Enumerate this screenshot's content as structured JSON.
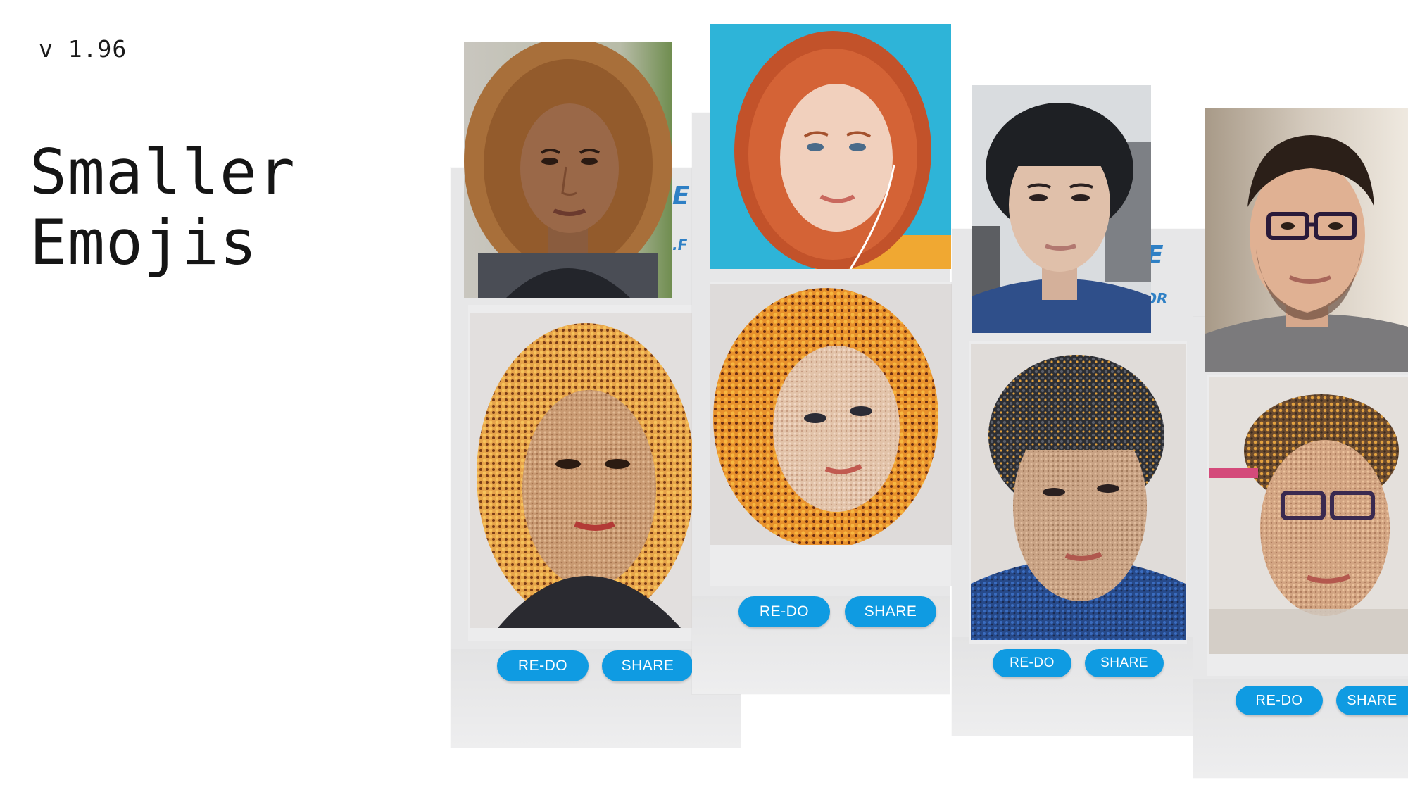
{
  "header": {
    "version": "v 1.96",
    "title_line1": "Smaller",
    "title_line2": "Emojis"
  },
  "cards": [
    {
      "subject": "woman with curly hair",
      "redo_label": "RE-DO",
      "share_label": "SHARE"
    },
    {
      "subject": "woman with red hair",
      "redo_label": "RE-DO",
      "share_label": "SHARE"
    },
    {
      "subject": "young man with dark hair",
      "redo_label": "RE-DO",
      "share_label": "SHARE"
    },
    {
      "subject": "man with glasses",
      "redo_label": "RE-DO",
      "share_label": "SHARE"
    }
  ],
  "colors": {
    "button": "#0f9be2",
    "card_background": "#e7e7e8",
    "photo2_background": "#2eb4d8"
  }
}
